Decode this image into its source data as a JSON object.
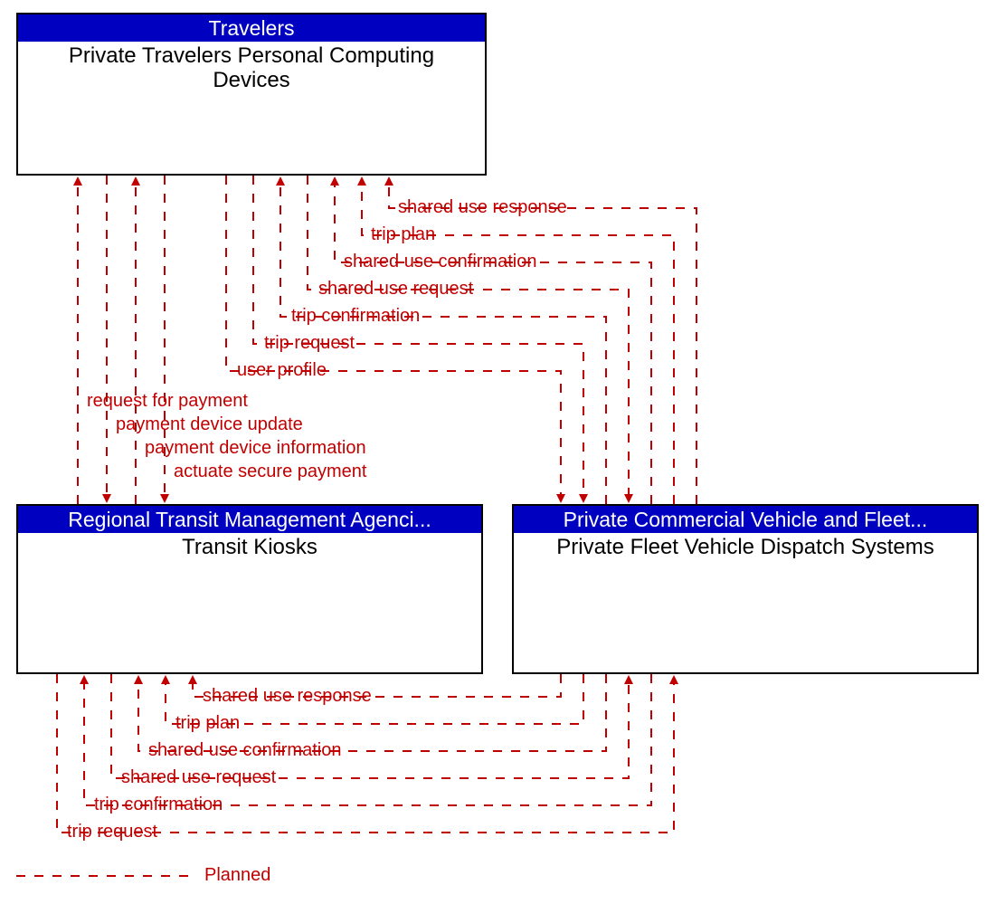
{
  "nodes": {
    "topLeft": {
      "header": "Travelers",
      "body1": "Private Travelers Personal Computing",
      "body2": "Devices"
    },
    "bottomLeft": {
      "header": "Regional Transit Management Agenci...",
      "body": "Transit Kiosks"
    },
    "bottomRight": {
      "header": "Private Commercial Vehicle and Fleet...",
      "body": "Private Fleet Vehicle Dispatch Systems"
    }
  },
  "upperFlows": {
    "f1": "shared use response",
    "f2": "trip plan",
    "f3": "shared use confirmation",
    "f4": "shared use request",
    "f5": "trip confirmation",
    "f6": "trip request",
    "f7": "user profile"
  },
  "paymentFlows": {
    "p1": "request for payment",
    "p2": "payment device update",
    "p3": "payment device information",
    "p4": "actuate secure payment"
  },
  "lowerFlows": {
    "l1": "shared use response",
    "l2": "trip plan",
    "l3": "shared use confirmation",
    "l4": "shared use request",
    "l5": "trip confirmation",
    "l6": "trip request"
  },
  "legend": {
    "planned": "Planned"
  },
  "colors": {
    "planned": "#c00000",
    "header": "#0000c0",
    "border": "#000000"
  }
}
